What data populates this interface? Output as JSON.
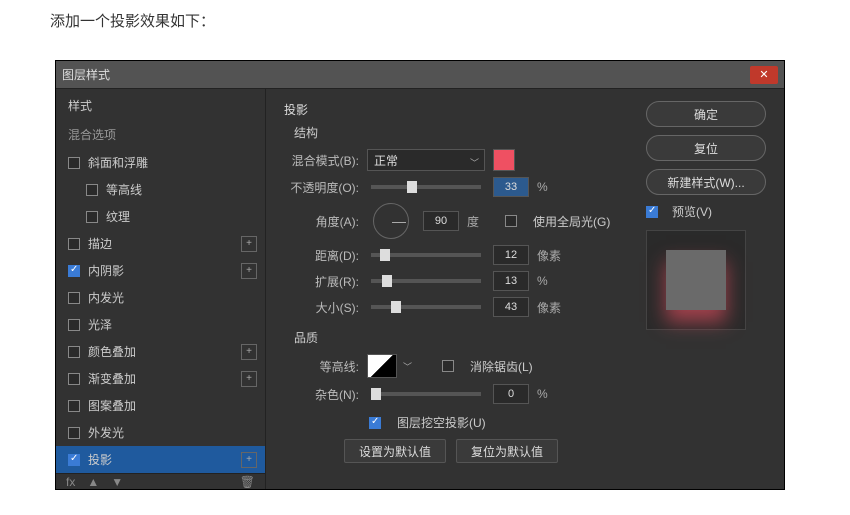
{
  "caption": "添加一个投影效果如下：",
  "dialog": {
    "title": "图层样式"
  },
  "left": {
    "styles_header": "样式",
    "blend_header": "混合选项",
    "items": [
      {
        "label": "斜面和浮雕",
        "checked": false,
        "plus": false,
        "sub": false
      },
      {
        "label": "等高线",
        "checked": false,
        "plus": false,
        "sub": true
      },
      {
        "label": "纹理",
        "checked": false,
        "plus": false,
        "sub": true
      },
      {
        "label": "描边",
        "checked": false,
        "plus": true,
        "sub": false
      },
      {
        "label": "内阴影",
        "checked": true,
        "plus": true,
        "sub": false
      },
      {
        "label": "内发光",
        "checked": false,
        "plus": false,
        "sub": false
      },
      {
        "label": "光泽",
        "checked": false,
        "plus": false,
        "sub": false
      },
      {
        "label": "颜色叠加",
        "checked": false,
        "plus": true,
        "sub": false
      },
      {
        "label": "渐变叠加",
        "checked": false,
        "plus": true,
        "sub": false
      },
      {
        "label": "图案叠加",
        "checked": false,
        "plus": false,
        "sub": false
      },
      {
        "label": "外发光",
        "checked": false,
        "plus": false,
        "sub": false
      },
      {
        "label": "投影",
        "checked": true,
        "plus": true,
        "sub": false,
        "selected": true
      }
    ],
    "fx": "fx"
  },
  "mid": {
    "title": "投影",
    "structure": "结构",
    "blend_mode_label": "混合模式(B):",
    "blend_mode_value": "正常",
    "opacity_label": "不透明度(O):",
    "opacity_value": "33",
    "opacity_unit": "%",
    "angle_label": "角度(A):",
    "angle_value": "90",
    "angle_unit": "度",
    "global_light": "使用全局光(G)",
    "distance_label": "距离(D):",
    "distance_value": "12",
    "distance_unit": "像素",
    "spread_label": "扩展(R):",
    "spread_value": "13",
    "spread_unit": "%",
    "size_label": "大小(S):",
    "size_value": "43",
    "size_unit": "像素",
    "quality": "品质",
    "contour_label": "等高线:",
    "antialias": "消除锯齿(L)",
    "noise_label": "杂色(N):",
    "noise_value": "0",
    "noise_unit": "%",
    "knockout": "图层挖空投影(U)",
    "set_default": "设置为默认值",
    "reset_default": "复位为默认值"
  },
  "right": {
    "ok": "确定",
    "reset": "复位",
    "new_style": "新建样式(W)...",
    "preview": "预览(V)"
  }
}
